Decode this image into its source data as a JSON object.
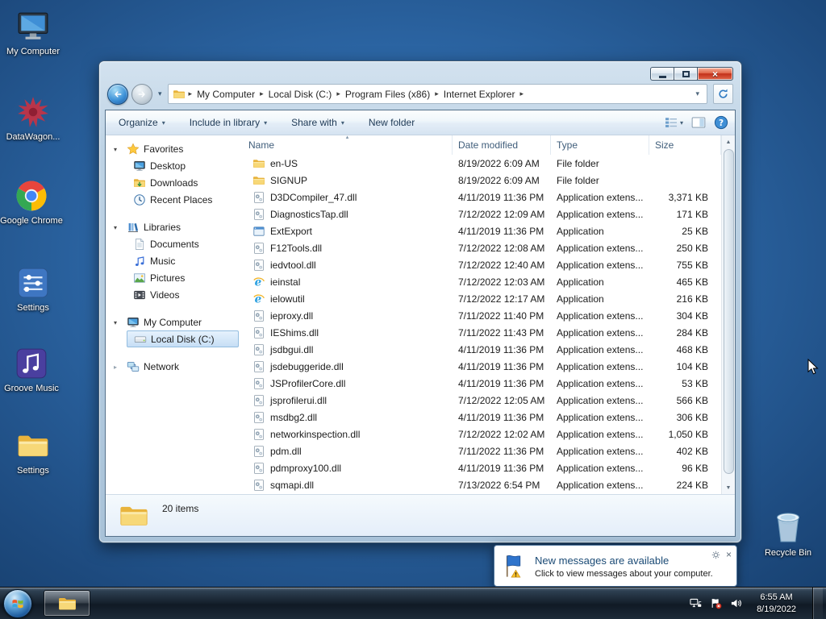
{
  "desktop": {
    "icons": [
      {
        "label": "My Computer",
        "icon": "my-computer"
      },
      {
        "label": "DataWagon...",
        "icon": "datawagon"
      },
      {
        "label": "Google Chrome",
        "icon": "google-chrome"
      },
      {
        "label": "Settings",
        "icon": "settings-app"
      },
      {
        "label": "Groove Music",
        "icon": "groove-music"
      },
      {
        "label": "Settings",
        "icon": "settings-folder"
      }
    ],
    "recycle_bin_label": "Recycle Bin"
  },
  "explorer": {
    "nav": {
      "breadcrumbs": [
        "My Computer",
        "Local Disk (C:)",
        "Program Files (x86)",
        "Internet Explorer"
      ]
    },
    "toolbar": {
      "items": [
        {
          "label": "Organize",
          "dropdown": true
        },
        {
          "label": "Include in library",
          "dropdown": true
        },
        {
          "label": "Share with",
          "dropdown": true
        },
        {
          "label": "New folder",
          "dropdown": false
        }
      ]
    },
    "sidebar": {
      "sections": [
        {
          "label": "Favorites",
          "expanded": true,
          "icon": "star",
          "items": [
            {
              "label": "Desktop",
              "icon": "desktop"
            },
            {
              "label": "Downloads",
              "icon": "downloads"
            },
            {
              "label": "Recent Places",
              "icon": "recent"
            }
          ]
        },
        {
          "label": "Libraries",
          "expanded": true,
          "icon": "libraries",
          "items": [
            {
              "label": "Documents",
              "icon": "documents"
            },
            {
              "label": "Music",
              "icon": "music"
            },
            {
              "label": "Pictures",
              "icon": "pictures"
            },
            {
              "label": "Videos",
              "icon": "videos"
            }
          ]
        },
        {
          "label": "My Computer",
          "expanded": true,
          "icon": "computer",
          "items": [
            {
              "label": "Local Disk (C:)",
              "icon": "disk",
              "selected": true
            }
          ]
        },
        {
          "label": "Network",
          "expanded": false,
          "icon": "network",
          "items": []
        }
      ]
    },
    "columns": [
      "Name",
      "Date modified",
      "Type",
      "Size"
    ],
    "sort_column": "Name",
    "files": [
      {
        "name": "en-US",
        "date": "8/19/2022 6:09 AM",
        "type": "File folder",
        "size": "",
        "icon": "folder"
      },
      {
        "name": "SIGNUP",
        "date": "8/19/2022 6:09 AM",
        "type": "File folder",
        "size": "",
        "icon": "folder"
      },
      {
        "name": "D3DCompiler_47.dll",
        "date": "4/11/2019 11:36 PM",
        "type": "Application extens...",
        "size": "3,371 KB",
        "icon": "dll"
      },
      {
        "name": "DiagnosticsTap.dll",
        "date": "7/12/2022 12:09 AM",
        "type": "Application extens...",
        "size": "171 KB",
        "icon": "dll"
      },
      {
        "name": "ExtExport",
        "date": "4/11/2019 11:36 PM",
        "type": "Application",
        "size": "25 KB",
        "icon": "app"
      },
      {
        "name": "F12Tools.dll",
        "date": "7/12/2022 12:08 AM",
        "type": "Application extens...",
        "size": "250 KB",
        "icon": "dll"
      },
      {
        "name": "iedvtool.dll",
        "date": "7/12/2022 12:40 AM",
        "type": "Application extens...",
        "size": "755 KB",
        "icon": "dll"
      },
      {
        "name": "ieinstal",
        "date": "7/12/2022 12:03 AM",
        "type": "Application",
        "size": "465 KB",
        "icon": "ie"
      },
      {
        "name": "ielowutil",
        "date": "7/12/2022 12:17 AM",
        "type": "Application",
        "size": "216 KB",
        "icon": "ie"
      },
      {
        "name": "ieproxy.dll",
        "date": "7/11/2022 11:40 PM",
        "type": "Application extens...",
        "size": "304 KB",
        "icon": "dll"
      },
      {
        "name": "IEShims.dll",
        "date": "7/11/2022 11:43 PM",
        "type": "Application extens...",
        "size": "284 KB",
        "icon": "dll"
      },
      {
        "name": "jsdbgui.dll",
        "date": "4/11/2019 11:36 PM",
        "type": "Application extens...",
        "size": "468 KB",
        "icon": "dll"
      },
      {
        "name": "jsdebuggeride.dll",
        "date": "4/11/2019 11:36 PM",
        "type": "Application extens...",
        "size": "104 KB",
        "icon": "dll"
      },
      {
        "name": "JSProfilerCore.dll",
        "date": "4/11/2019 11:36 PM",
        "type": "Application extens...",
        "size": "53 KB",
        "icon": "dll"
      },
      {
        "name": "jsprofilerui.dll",
        "date": "7/12/2022 12:05 AM",
        "type": "Application extens...",
        "size": "566 KB",
        "icon": "dll"
      },
      {
        "name": "msdbg2.dll",
        "date": "4/11/2019 11:36 PM",
        "type": "Application extens...",
        "size": "306 KB",
        "icon": "dll"
      },
      {
        "name": "networkinspection.dll",
        "date": "7/12/2022 12:02 AM",
        "type": "Application extens...",
        "size": "1,050 KB",
        "icon": "dll"
      },
      {
        "name": "pdm.dll",
        "date": "7/11/2022 11:36 PM",
        "type": "Application extens...",
        "size": "402 KB",
        "icon": "dll"
      },
      {
        "name": "pdmproxy100.dll",
        "date": "4/11/2019 11:36 PM",
        "type": "Application extens...",
        "size": "96 KB",
        "icon": "dll"
      },
      {
        "name": "sqmapi.dll",
        "date": "7/13/2022 6:54 PM",
        "type": "Application extens...",
        "size": "224 KB",
        "icon": "dll"
      }
    ],
    "status_text": "20 items"
  },
  "notification": {
    "title": "New messages are available",
    "body": "Click to view messages about your computer."
  },
  "taskbar": {
    "clock_time": "6:55 AM",
    "clock_date": "8/19/2022"
  }
}
